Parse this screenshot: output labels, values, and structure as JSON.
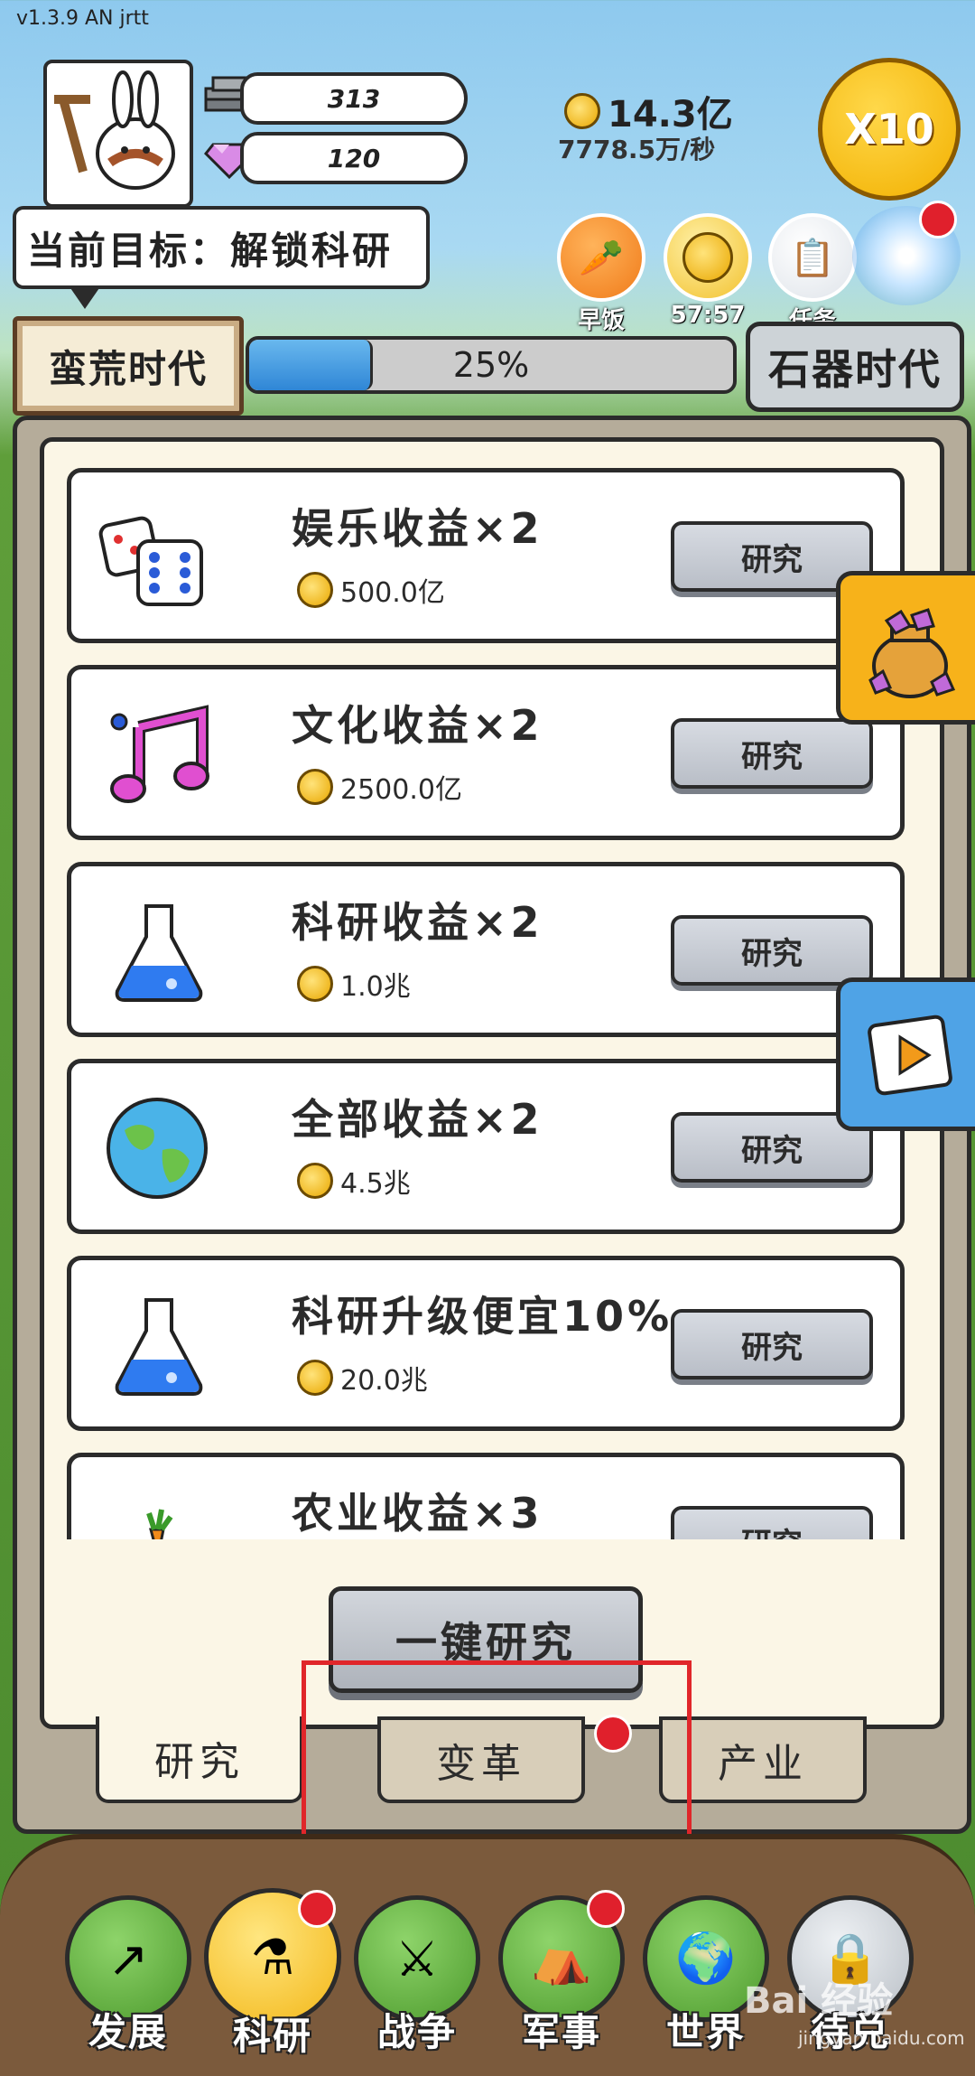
{
  "status": {
    "version": "v1.3.9 AN jrtt"
  },
  "resources": {
    "stone": "313",
    "gems": "120"
  },
  "gold": {
    "total": "14.3亿",
    "rate": "7778.5万/秒"
  },
  "boost": {
    "label": "X10"
  },
  "goal": {
    "text": "当前目标：解锁科研"
  },
  "quick_buttons": [
    {
      "label": "早饭",
      "icon": "carrot-icon"
    },
    {
      "label": "57:57",
      "icon": "coin-stack-icon"
    },
    {
      "label": "任务",
      "icon": "clipboard-icon"
    }
  ],
  "era": {
    "current": "蛮荒时代",
    "progress_text": "25%",
    "progress": 0.25,
    "next": "石器时代"
  },
  "research_items": [
    {
      "title": "娱乐收益×2",
      "cost": "500.0亿",
      "button": "研究",
      "icon": "dice-icon"
    },
    {
      "title": "文化收益×2",
      "cost": "2500.0亿",
      "button": "研究",
      "icon": "music-note-icon"
    },
    {
      "title": "科研收益×2",
      "cost": "1.0兆",
      "button": "研究",
      "icon": "flask-icon"
    },
    {
      "title": "全部收益×2",
      "cost": "4.5兆",
      "button": "研究",
      "icon": "globe-icon"
    },
    {
      "title": "科研升级便宜10%",
      "cost": "20.0兆",
      "button": "研究",
      "icon": "flask-icon"
    },
    {
      "title": "农业收益×3",
      "cost": "",
      "button": "研究",
      "icon": "carrot-icon"
    }
  ],
  "one_key": {
    "label": "一键研究"
  },
  "tabs": [
    {
      "label": "研究",
      "active": true
    },
    {
      "label": "变革",
      "active": false,
      "dot": true
    },
    {
      "label": "产业",
      "active": false
    }
  ],
  "nav": [
    {
      "label": "发展",
      "icon": "arrow-up-icon"
    },
    {
      "label": "科研",
      "icon": "flask-icon",
      "active": true,
      "dot": true
    },
    {
      "label": "战争",
      "icon": "crossed-swords-icon"
    },
    {
      "label": "军事",
      "icon": "tent-icon",
      "dot": true
    },
    {
      "label": "世界",
      "icon": "globe-icon"
    },
    {
      "label": "待兑",
      "icon": "locked-icon"
    }
  ],
  "watermark": {
    "main": "Bai 经验",
    "sub": "jingyan.baidu.com"
  },
  "colors": {
    "highlight": "#e0262a",
    "notification": "#e0202c",
    "progress": "#2f86d6"
  }
}
